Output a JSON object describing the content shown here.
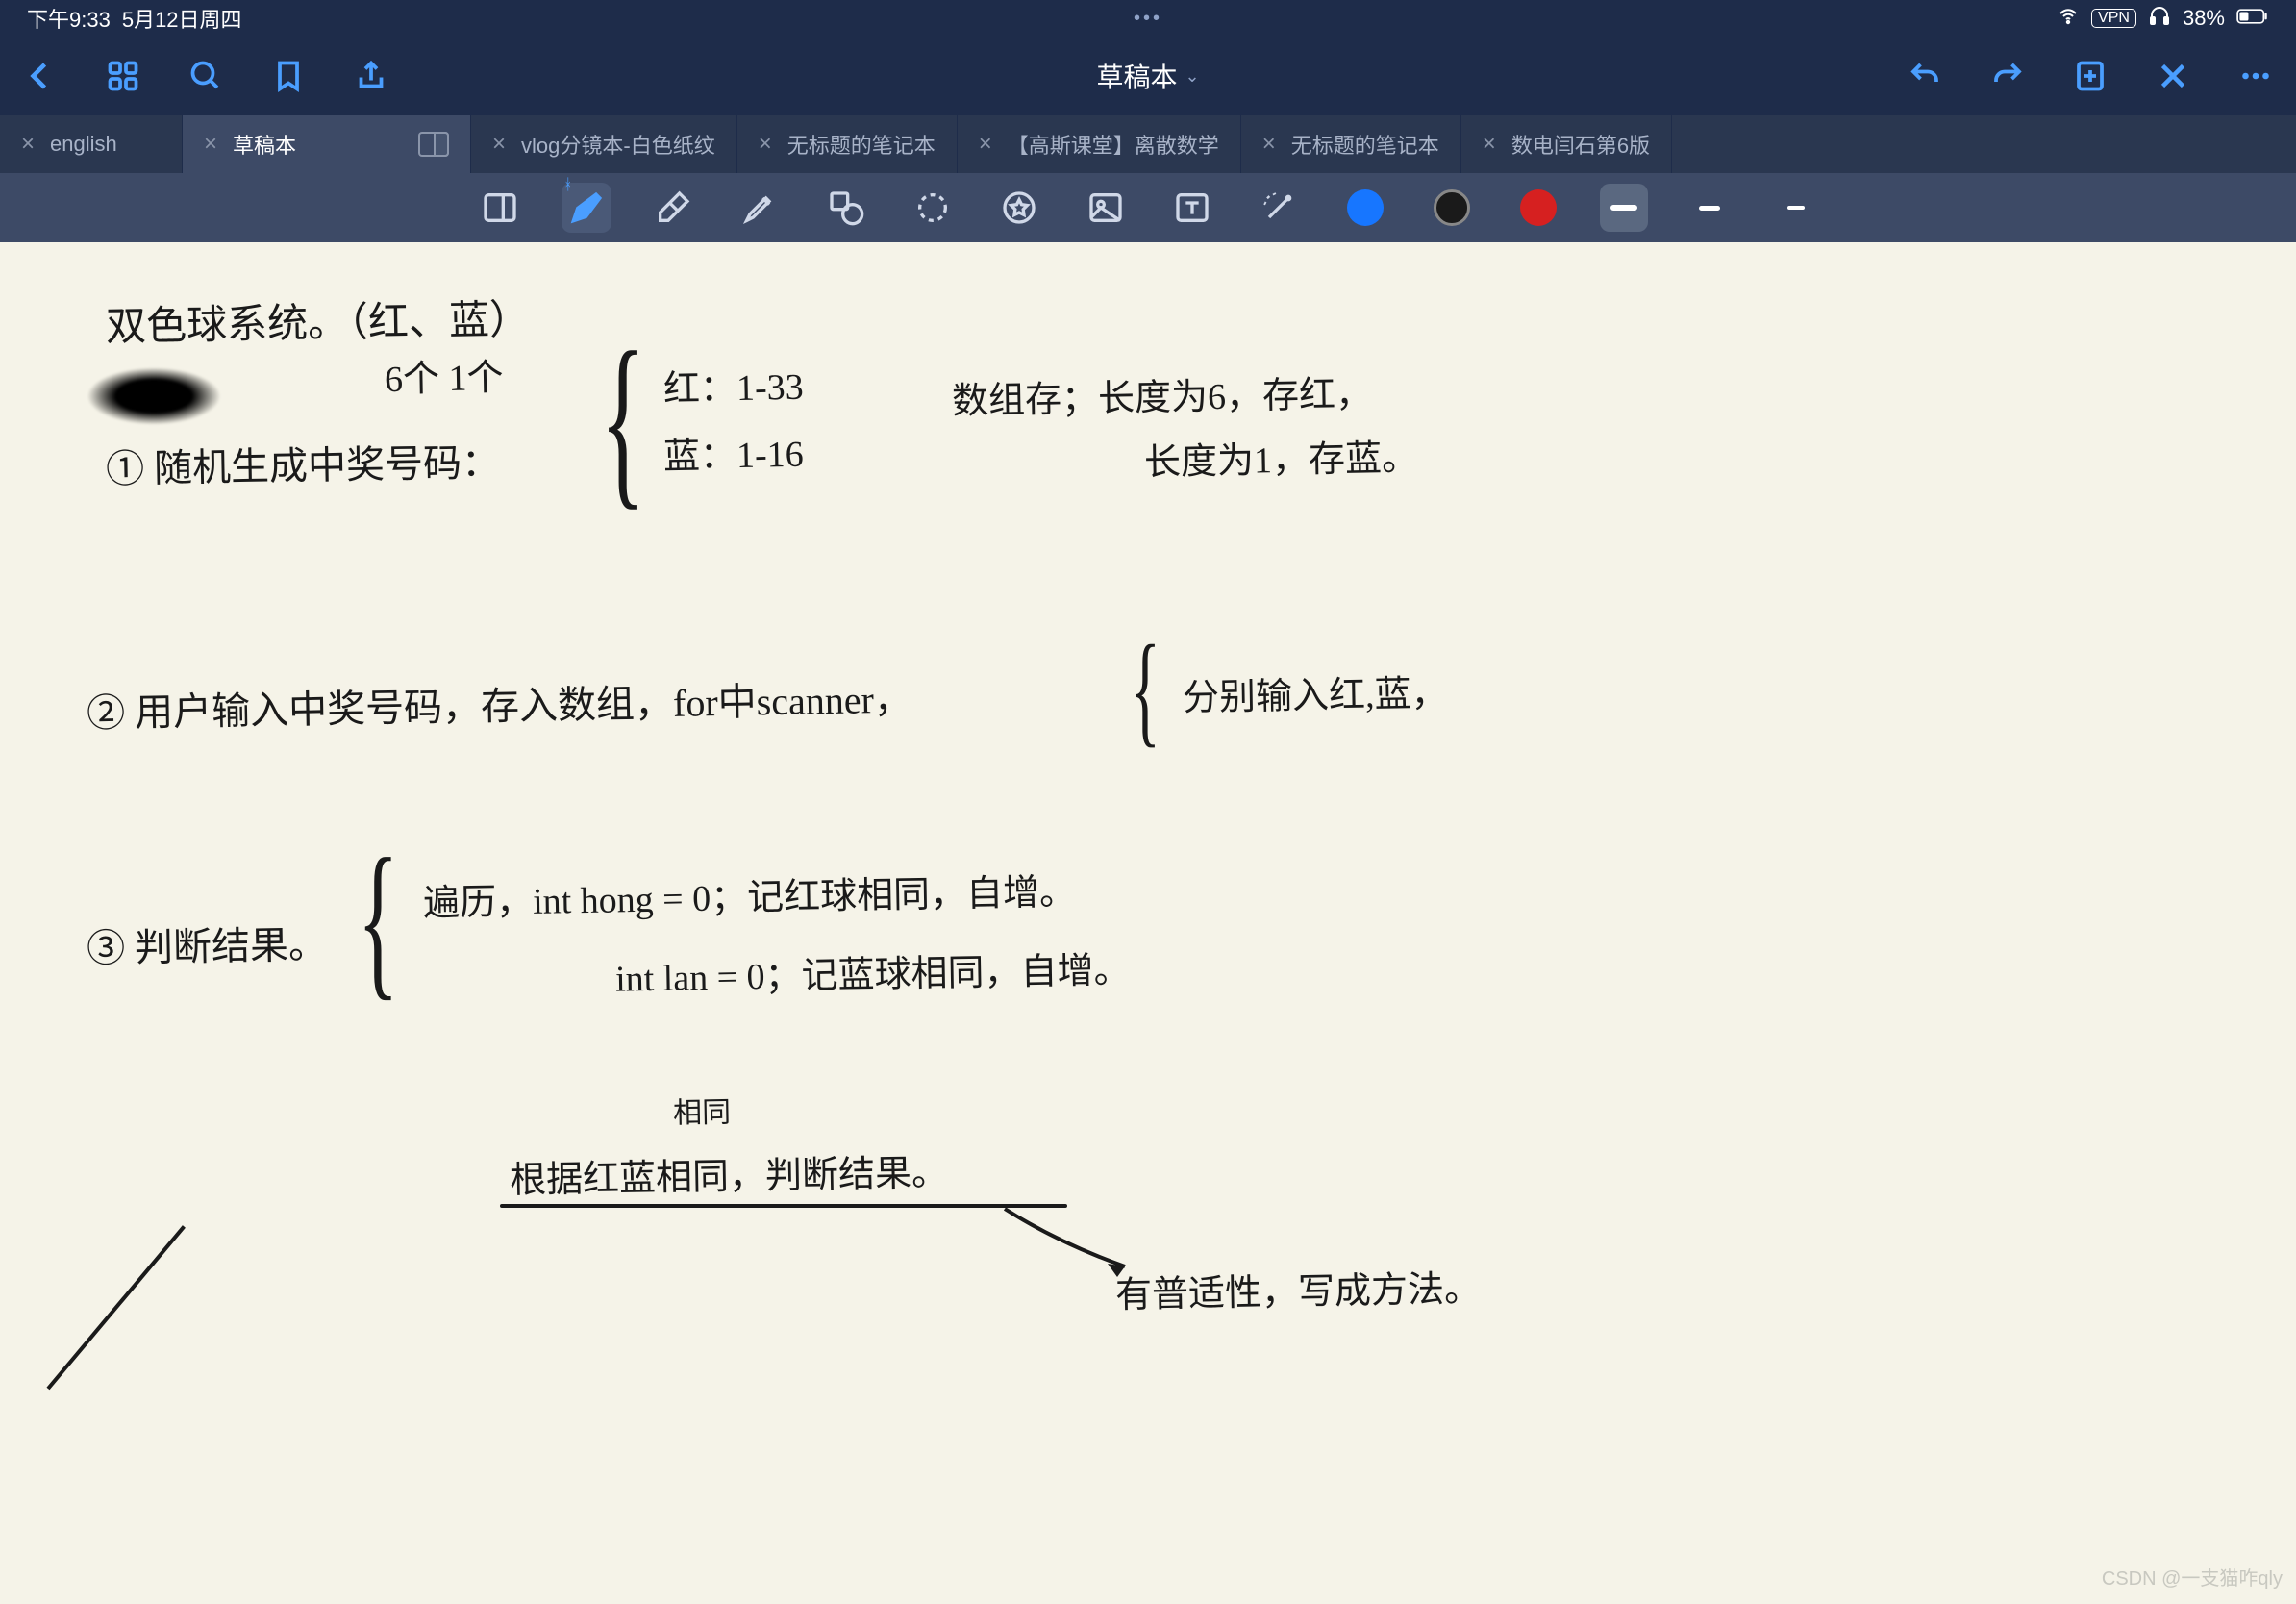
{
  "status": {
    "time": "下午9:33",
    "date": "5月12日周四",
    "vpn": "VPN",
    "battery": "38%"
  },
  "nav": {
    "title": "草稿本"
  },
  "tabs": [
    {
      "label": "english",
      "active": false
    },
    {
      "label": "草稿本",
      "active": true,
      "hasIcon": true
    },
    {
      "label": "vlog分镜本-白色纸纹",
      "active": false
    },
    {
      "label": "无标题的笔记本",
      "active": false
    },
    {
      "label": "【高斯课堂】离散数学",
      "active": false
    },
    {
      "label": "无标题的笔记本",
      "active": false
    },
    {
      "label": "数电闫石第6版",
      "active": false
    }
  ],
  "tools": {
    "colors": [
      "#1776ff",
      "#1a1a1a",
      "#d62020"
    ]
  },
  "notes": {
    "line1": "双色球系统。（红、蓝）",
    "line2a": "6个   1个",
    "line2b": "红：1-33",
    "line2c": "蓝：1-16",
    "line2d": "数组存；长度为6，存红，",
    "line2e": "长度为1，存蓝。",
    "line3": "① 随机生成中奖号码：",
    "line4": "② 用户输入中奖号码，存入数组，for中scanner，",
    "line4b": "分别输入红,蓝，",
    "line5": "③ 判断结果。",
    "line5b": "遍历，int hong = 0；记红球相同，自增。",
    "line5c": "int lan = 0；记蓝球相同，自增。",
    "line6": "根据红蓝相同，判断结果。",
    "line7": "有普适性，写成方法。",
    "annot1": "相同"
  },
  "watermark": "CSDN @一支猫咋qly"
}
